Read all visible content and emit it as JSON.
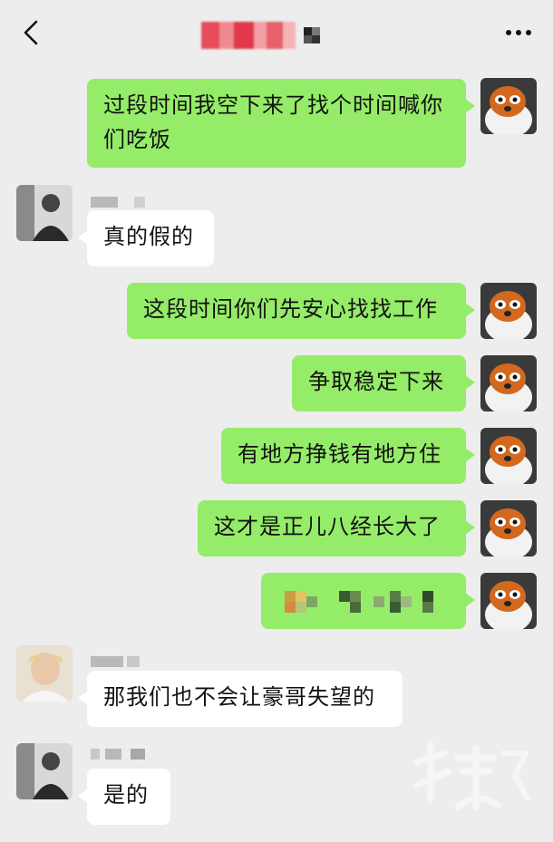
{
  "header": {
    "back_icon": "chevron-left-icon",
    "more_icon": "more-horizontal-icon",
    "title_obscured": true
  },
  "colors": {
    "background": "#ededed",
    "sent_bubble": "#95ec69",
    "received_bubble": "#ffffff"
  },
  "messages": [
    {
      "side": "sent",
      "text_line1": "过段时间我空下来了找个时间喊你",
      "text_line2": "们吃饭"
    },
    {
      "side": "received",
      "text": "真的假的"
    },
    {
      "side": "sent",
      "text": "这段时间你们先安心找找工作"
    },
    {
      "side": "sent",
      "text": "争取稳定下来"
    },
    {
      "side": "sent",
      "text": "有地方挣钱有地方住"
    },
    {
      "side": "sent",
      "text": "这才是正儿八经长大了"
    },
    {
      "side": "sent",
      "content": "pixelated-blur"
    },
    {
      "side": "received",
      "text": "那我们也不会让豪哥失望的"
    },
    {
      "side": "received",
      "text": "是的"
    }
  ]
}
